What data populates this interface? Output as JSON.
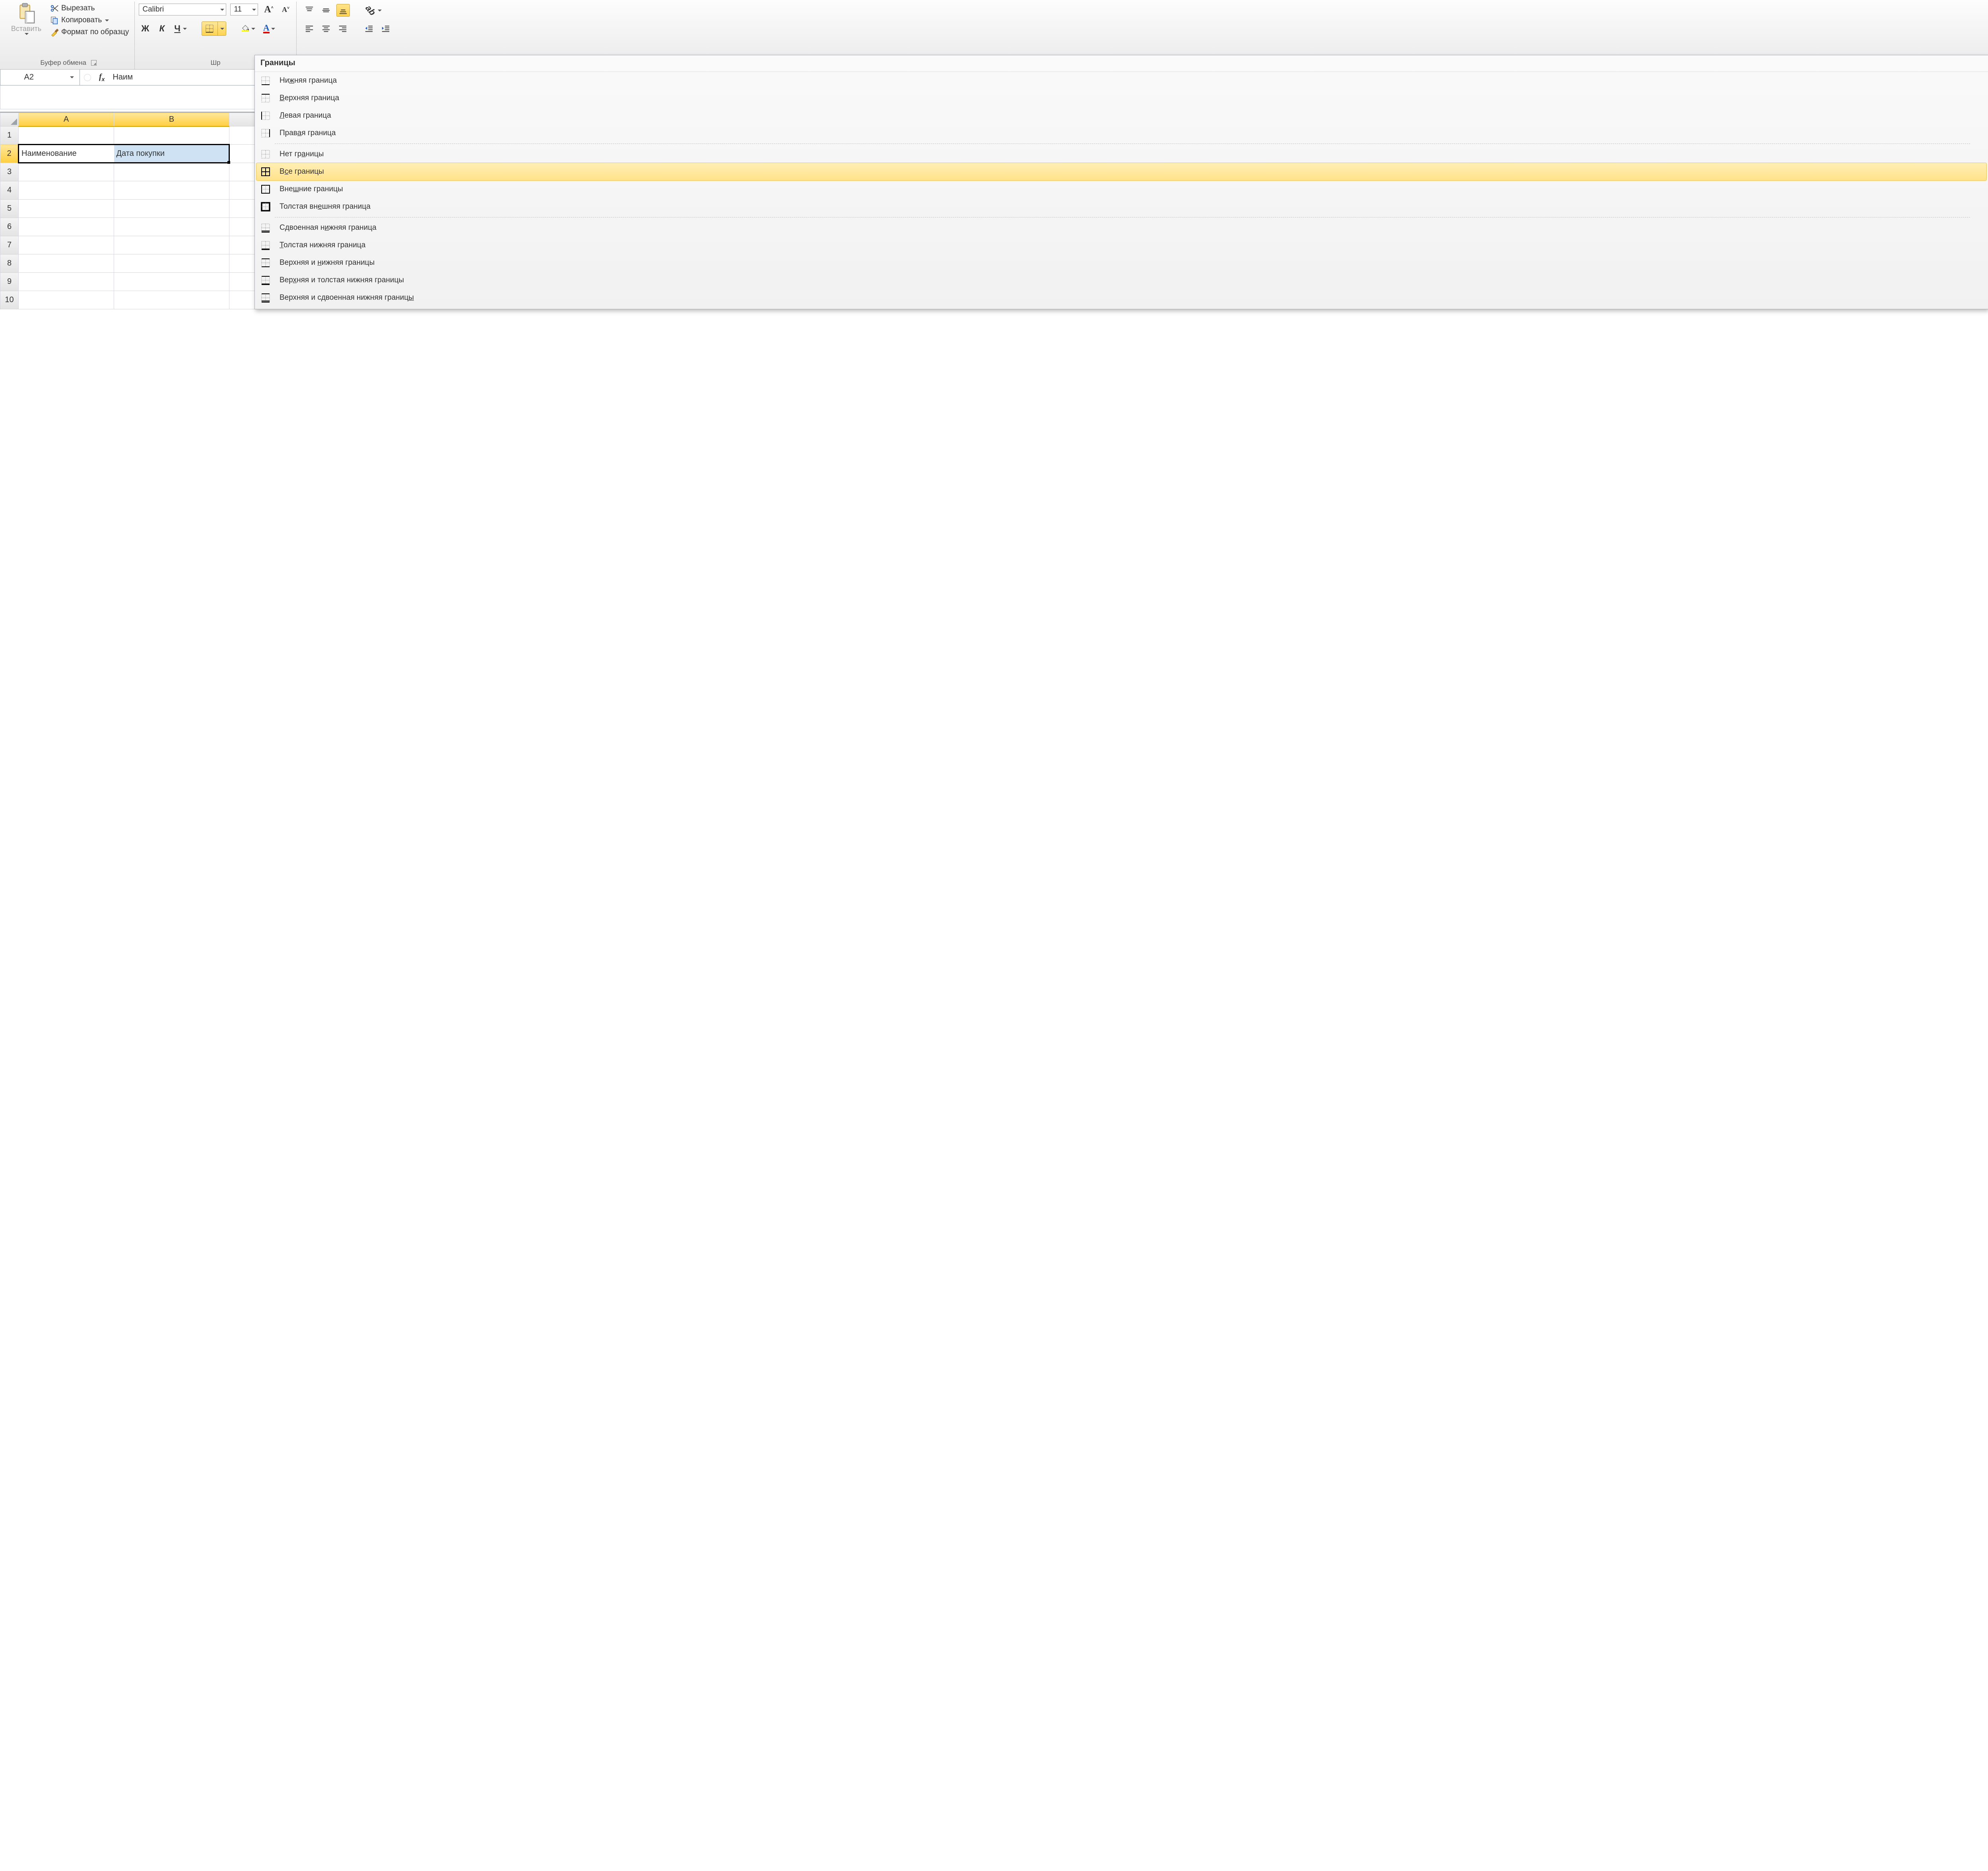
{
  "ribbon": {
    "clipboard": {
      "paste": "Вставить",
      "cut": "Вырезать",
      "copy": "Копировать",
      "format_painter": "Формат по образцу",
      "group_title": "Буфер обмена"
    },
    "font": {
      "name": "Calibri",
      "size": "11",
      "bold": "Ж",
      "italic": "К",
      "underline": "Ч",
      "group_title_partial": "Шр"
    }
  },
  "namebox": {
    "cell_ref": "A2",
    "formula_preview": "Наим"
  },
  "columns": [
    "A",
    "B"
  ],
  "rows": [
    "1",
    "2",
    "3",
    "4",
    "5",
    "6",
    "7",
    "8",
    "9",
    "10"
  ],
  "cells": {
    "A2": "Наименование",
    "B2": "Дата покупки"
  },
  "dropdown": {
    "header": "Границы",
    "items": [
      {
        "label_pre": "Ни",
        "mn": "ж",
        "label_post": "няя граница",
        "icon": "border-bottom"
      },
      {
        "label_pre": "",
        "mn": "В",
        "label_post": "ерхняя граница",
        "icon": "border-top"
      },
      {
        "label_pre": "",
        "mn": "Л",
        "label_post": "евая граница",
        "icon": "border-left"
      },
      {
        "label_pre": "Прав",
        "mn": "а",
        "label_post": "я граница",
        "icon": "border-right"
      },
      {
        "sep": true
      },
      {
        "label_pre": "Нет гр",
        "mn": "а",
        "label_post": "ницы",
        "icon": "border-none"
      },
      {
        "label_pre": "В",
        "mn": "с",
        "label_post": "е границы",
        "icon": "border-all",
        "highlight": true
      },
      {
        "label_pre": "Вне",
        "mn": "ш",
        "label_post": "ние границы",
        "icon": "border-outer"
      },
      {
        "label_pre": "Толстая вн",
        "mn": "е",
        "label_post": "шняя граница",
        "icon": "border-thick"
      },
      {
        "sep": true
      },
      {
        "label_pre": "Сдвоенная н",
        "mn": "и",
        "label_post": "жняя граница",
        "icon": "border-double-bottom"
      },
      {
        "label_pre": "",
        "mn": "Т",
        "label_post": "олстая нижняя граница",
        "icon": "border-thick-bottom"
      },
      {
        "label_pre": "Верхняя и ",
        "mn": "н",
        "label_post": "ижняя границы",
        "icon": "border-top-bottom"
      },
      {
        "label_pre": "Вер",
        "mn": "х",
        "label_post": "няя и толстая нижняя границы",
        "icon": "border-top-thick-bottom"
      },
      {
        "label_pre": "Верхняя и сдвоенная нижняя границ",
        "mn": "ы",
        "label_post": "",
        "icon": "border-top-double-bottom"
      }
    ]
  }
}
